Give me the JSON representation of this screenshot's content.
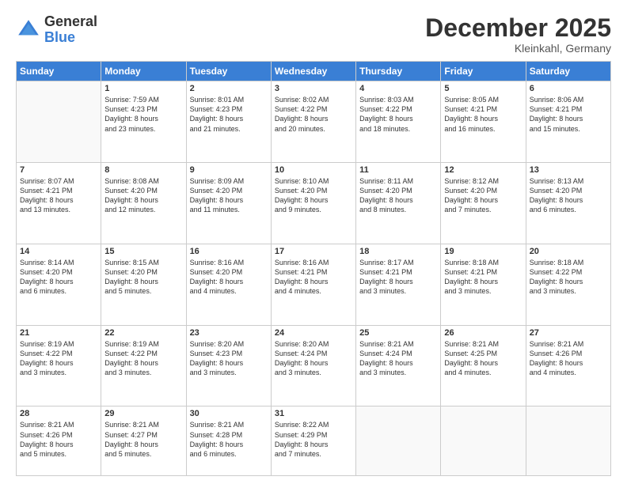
{
  "logo": {
    "general": "General",
    "blue": "Blue"
  },
  "title": "December 2025",
  "location": "Kleinkahl, Germany",
  "days_of_week": [
    "Sunday",
    "Monday",
    "Tuesday",
    "Wednesday",
    "Thursday",
    "Friday",
    "Saturday"
  ],
  "weeks": [
    [
      {
        "num": "",
        "sunrise": "",
        "sunset": "",
        "daylight": "",
        "empty": true
      },
      {
        "num": "1",
        "sunrise": "Sunrise: 7:59 AM",
        "sunset": "Sunset: 4:23 PM",
        "daylight": "Daylight: 8 hours and 23 minutes."
      },
      {
        "num": "2",
        "sunrise": "Sunrise: 8:01 AM",
        "sunset": "Sunset: 4:23 PM",
        "daylight": "Daylight: 8 hours and 21 minutes."
      },
      {
        "num": "3",
        "sunrise": "Sunrise: 8:02 AM",
        "sunset": "Sunset: 4:22 PM",
        "daylight": "Daylight: 8 hours and 20 minutes."
      },
      {
        "num": "4",
        "sunrise": "Sunrise: 8:03 AM",
        "sunset": "Sunset: 4:22 PM",
        "daylight": "Daylight: 8 hours and 18 minutes."
      },
      {
        "num": "5",
        "sunrise": "Sunrise: 8:05 AM",
        "sunset": "Sunset: 4:21 PM",
        "daylight": "Daylight: 8 hours and 16 minutes."
      },
      {
        "num": "6",
        "sunrise": "Sunrise: 8:06 AM",
        "sunset": "Sunset: 4:21 PM",
        "daylight": "Daylight: 8 hours and 15 minutes."
      }
    ],
    [
      {
        "num": "7",
        "sunrise": "Sunrise: 8:07 AM",
        "sunset": "Sunset: 4:21 PM",
        "daylight": "Daylight: 8 hours and 13 minutes."
      },
      {
        "num": "8",
        "sunrise": "Sunrise: 8:08 AM",
        "sunset": "Sunset: 4:20 PM",
        "daylight": "Daylight: 8 hours and 12 minutes."
      },
      {
        "num": "9",
        "sunrise": "Sunrise: 8:09 AM",
        "sunset": "Sunset: 4:20 PM",
        "daylight": "Daylight: 8 hours and 11 minutes."
      },
      {
        "num": "10",
        "sunrise": "Sunrise: 8:10 AM",
        "sunset": "Sunset: 4:20 PM",
        "daylight": "Daylight: 8 hours and 9 minutes."
      },
      {
        "num": "11",
        "sunrise": "Sunrise: 8:11 AM",
        "sunset": "Sunset: 4:20 PM",
        "daylight": "Daylight: 8 hours and 8 minutes."
      },
      {
        "num": "12",
        "sunrise": "Sunrise: 8:12 AM",
        "sunset": "Sunset: 4:20 PM",
        "daylight": "Daylight: 8 hours and 7 minutes."
      },
      {
        "num": "13",
        "sunrise": "Sunrise: 8:13 AM",
        "sunset": "Sunset: 4:20 PM",
        "daylight": "Daylight: 8 hours and 6 minutes."
      }
    ],
    [
      {
        "num": "14",
        "sunrise": "Sunrise: 8:14 AM",
        "sunset": "Sunset: 4:20 PM",
        "daylight": "Daylight: 8 hours and 6 minutes."
      },
      {
        "num": "15",
        "sunrise": "Sunrise: 8:15 AM",
        "sunset": "Sunset: 4:20 PM",
        "daylight": "Daylight: 8 hours and 5 minutes."
      },
      {
        "num": "16",
        "sunrise": "Sunrise: 8:16 AM",
        "sunset": "Sunset: 4:20 PM",
        "daylight": "Daylight: 8 hours and 4 minutes."
      },
      {
        "num": "17",
        "sunrise": "Sunrise: 8:16 AM",
        "sunset": "Sunset: 4:21 PM",
        "daylight": "Daylight: 8 hours and 4 minutes."
      },
      {
        "num": "18",
        "sunrise": "Sunrise: 8:17 AM",
        "sunset": "Sunset: 4:21 PM",
        "daylight": "Daylight: 8 hours and 3 minutes."
      },
      {
        "num": "19",
        "sunrise": "Sunrise: 8:18 AM",
        "sunset": "Sunset: 4:21 PM",
        "daylight": "Daylight: 8 hours and 3 minutes."
      },
      {
        "num": "20",
        "sunrise": "Sunrise: 8:18 AM",
        "sunset": "Sunset: 4:22 PM",
        "daylight": "Daylight: 8 hours and 3 minutes."
      }
    ],
    [
      {
        "num": "21",
        "sunrise": "Sunrise: 8:19 AM",
        "sunset": "Sunset: 4:22 PM",
        "daylight": "Daylight: 8 hours and 3 minutes."
      },
      {
        "num": "22",
        "sunrise": "Sunrise: 8:19 AM",
        "sunset": "Sunset: 4:22 PM",
        "daylight": "Daylight: 8 hours and 3 minutes."
      },
      {
        "num": "23",
        "sunrise": "Sunrise: 8:20 AM",
        "sunset": "Sunset: 4:23 PM",
        "daylight": "Daylight: 8 hours and 3 minutes."
      },
      {
        "num": "24",
        "sunrise": "Sunrise: 8:20 AM",
        "sunset": "Sunset: 4:24 PM",
        "daylight": "Daylight: 8 hours and 3 minutes."
      },
      {
        "num": "25",
        "sunrise": "Sunrise: 8:21 AM",
        "sunset": "Sunset: 4:24 PM",
        "daylight": "Daylight: 8 hours and 3 minutes."
      },
      {
        "num": "26",
        "sunrise": "Sunrise: 8:21 AM",
        "sunset": "Sunset: 4:25 PM",
        "daylight": "Daylight: 8 hours and 4 minutes."
      },
      {
        "num": "27",
        "sunrise": "Sunrise: 8:21 AM",
        "sunset": "Sunset: 4:26 PM",
        "daylight": "Daylight: 8 hours and 4 minutes."
      }
    ],
    [
      {
        "num": "28",
        "sunrise": "Sunrise: 8:21 AM",
        "sunset": "Sunset: 4:26 PM",
        "daylight": "Daylight: 8 hours and 5 minutes."
      },
      {
        "num": "29",
        "sunrise": "Sunrise: 8:21 AM",
        "sunset": "Sunset: 4:27 PM",
        "daylight": "Daylight: 8 hours and 5 minutes."
      },
      {
        "num": "30",
        "sunrise": "Sunrise: 8:21 AM",
        "sunset": "Sunset: 4:28 PM",
        "daylight": "Daylight: 8 hours and 6 minutes."
      },
      {
        "num": "31",
        "sunrise": "Sunrise: 8:22 AM",
        "sunset": "Sunset: 4:29 PM",
        "daylight": "Daylight: 8 hours and 7 minutes."
      },
      {
        "num": "",
        "sunrise": "",
        "sunset": "",
        "daylight": "",
        "empty": true
      },
      {
        "num": "",
        "sunrise": "",
        "sunset": "",
        "daylight": "",
        "empty": true
      },
      {
        "num": "",
        "sunrise": "",
        "sunset": "",
        "daylight": "",
        "empty": true
      }
    ]
  ]
}
